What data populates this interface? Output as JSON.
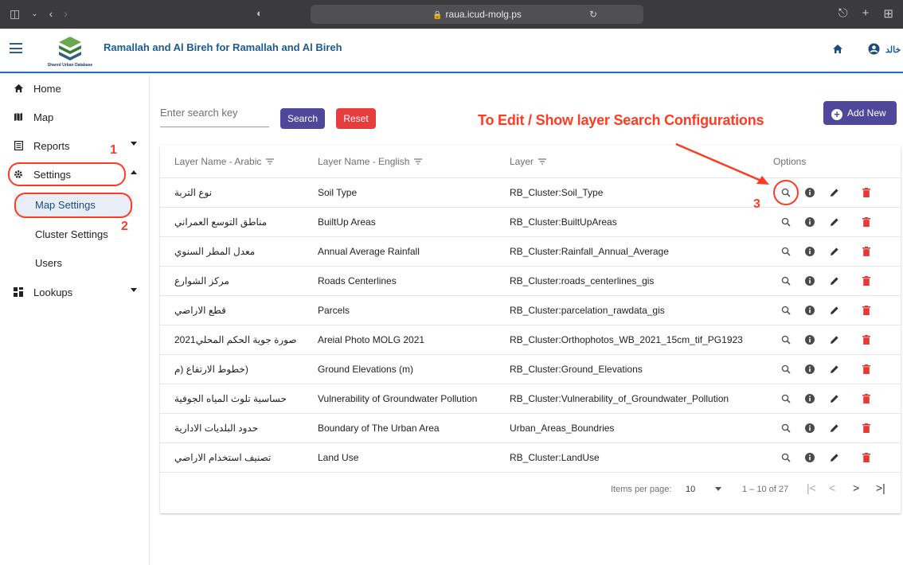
{
  "browser": {
    "url": "raua.icud-molg.ps"
  },
  "header": {
    "title": "Ramallah and Al Bireh for Ramallah and Al Bireh",
    "logo_text": "Shared Urban Database",
    "user_name": "خالد"
  },
  "sidebar": {
    "items": [
      {
        "label": "Home",
        "icon": "home-icon"
      },
      {
        "label": "Map",
        "icon": "map-icon"
      },
      {
        "label": "Reports",
        "icon": "report-icon"
      },
      {
        "label": "Settings",
        "icon": "gear-icon"
      },
      {
        "label": "Lookups",
        "icon": "grid-icon"
      }
    ],
    "settings_children": [
      "Map Settings",
      "Cluster Settings",
      "Users"
    ]
  },
  "toolbar": {
    "search_placeholder": "Enter search key",
    "search_label": "Search",
    "reset_label": "Reset",
    "add_label": "Add New"
  },
  "annotations": {
    "headline": "To Edit / Show layer Search Configurations",
    "step1": "1",
    "step2": "2",
    "step3": "3"
  },
  "table": {
    "columns": [
      "Layer Name - Arabic",
      "Layer Name - English",
      "Layer",
      "Options"
    ],
    "rows": [
      {
        "ar": "نوع التربة",
        "en": "Soil Type",
        "layer": "RB_Cluster:Soil_Type"
      },
      {
        "ar": "مناطق التوسع العمراني",
        "en": "BuiltUp Areas",
        "layer": "RB_Cluster:BuiltUpAreas"
      },
      {
        "ar": "معدل المطر السنوي",
        "en": "Annual Average Rainfall",
        "layer": "RB_Cluster:Rainfall_Annual_Average"
      },
      {
        "ar": "مركز الشوارع",
        "en": "Roads Centerlines",
        "layer": "RB_Cluster:roads_centerlines_gis"
      },
      {
        "ar": "قطع الاراضي",
        "en": "Parcels",
        "layer": "RB_Cluster:parcelation_rawdata_gis"
      },
      {
        "ar": "صورة جوية الحكم المحلي2021",
        "en": "Areial Photo MOLG 2021",
        "layer": "RB_Cluster:Orthophotos_WB_2021_15cm_tif_PG1923"
      },
      {
        "ar": "(خطوط الارتفاع (م",
        "en": "Ground Elevations (m)",
        "layer": "RB_Cluster:Ground_Elevations"
      },
      {
        "ar": "حساسية تلوث المياه الجوفية",
        "en": "Vulnerability of Groundwater Pollution",
        "layer": "RB_Cluster:Vulnerability_of_Groundwater_Pollution"
      },
      {
        "ar": "حدود البلديات الادارية",
        "en": "Boundary of The Urban Area",
        "layer": "Urban_Areas_Boundries"
      },
      {
        "ar": "تصنيف استخدام الاراضي",
        "en": "Land Use",
        "layer": "RB_Cluster:LandUse"
      }
    ]
  },
  "pagination": {
    "items_per_page_label": "Items per page:",
    "page_size": "10",
    "range": "1 – 10 of 27"
  },
  "colors": {
    "primary": "#4f4799",
    "danger": "#e53d3d",
    "annotation": "#ff3b24",
    "header_blue": "#1a5b91"
  }
}
